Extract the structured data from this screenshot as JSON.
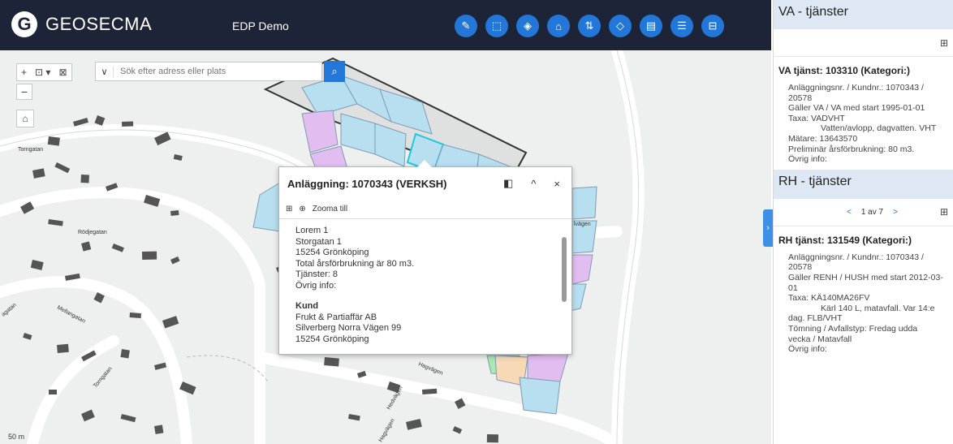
{
  "header": {
    "logo_letter": "G",
    "logo_text": "GEOSECMA",
    "app_title": "EDP Demo",
    "toolbar_icons": [
      "edit-icon",
      "select-rect-icon",
      "measure-icon",
      "house-icon",
      "tools-icon",
      "layers-icon",
      "report-icon",
      "list-icon",
      "database-icon"
    ]
  },
  "map": {
    "zoom_in": "+",
    "zoom_out": "−",
    "search_placeholder": "Sök efter adress eller plats",
    "scale_label": "50 m",
    "street_labels": [
      "Torngatan",
      "Rödjegatan",
      "Mellangatan",
      "Torngatan",
      "Hagvägen",
      "Hagvägen",
      "Hedvägen",
      "lvägen",
      "agatan"
    ]
  },
  "popup": {
    "title": "Anläggning: 1070343 (VERKSH)",
    "zoom_label": "Zooma till",
    "lines": [
      "Lorem 1",
      "Storgatan 1",
      "15254 Grönköping",
      "Total årsförbrukning är 80  m3.",
      "Tjänster: 8",
      "Övrig info:"
    ],
    "kund_heading": "Kund",
    "kund_lines": [
      "Frukt & Partiaffär AB",
      "Silverberg Norra Vägen 99",
      "15254  Grönköping"
    ]
  },
  "panel": {
    "va": {
      "heading": "VA - tjänster",
      "title": "VA tjänst: 103310 (Kategori:)",
      "lines": [
        "Anläggningsnr. / Kundnr.: 1070343 /",
        "20578",
        "Gäller VA / VA med start 1995-01-01",
        "Taxa:   VADVHT"
      ],
      "taxa_desc": "Vatten/avlopp, dagvatten. VHT",
      "after": [
        "Mätare: 13643570",
        "Preliminär årsförbrukning: 80 m3.",
        "Övrig info:"
      ]
    },
    "rh": {
      "heading": "RH - tjänster",
      "pager_prev": "<",
      "pager_text": "1 av 7",
      "pager_next": ">",
      "title": "RH tjänst: 131549 (Kategori:)",
      "lines": [
        "Anläggningsnr. / Kundnr.: 1070343 /",
        "20578",
        "Gäller RENH / HUSH med start 2012-03-",
        "01",
        "Taxa:   KÄ140MA26FV"
      ],
      "taxa_desc": "Kärl 140 L, matavfall. Var 14:e",
      "after": [
        "dag. FLB/VHT",
        "Tömning / Avfallstyp: Fredag udda",
        "vecka  / Matavfall",
        "Övrig info:"
      ]
    }
  }
}
